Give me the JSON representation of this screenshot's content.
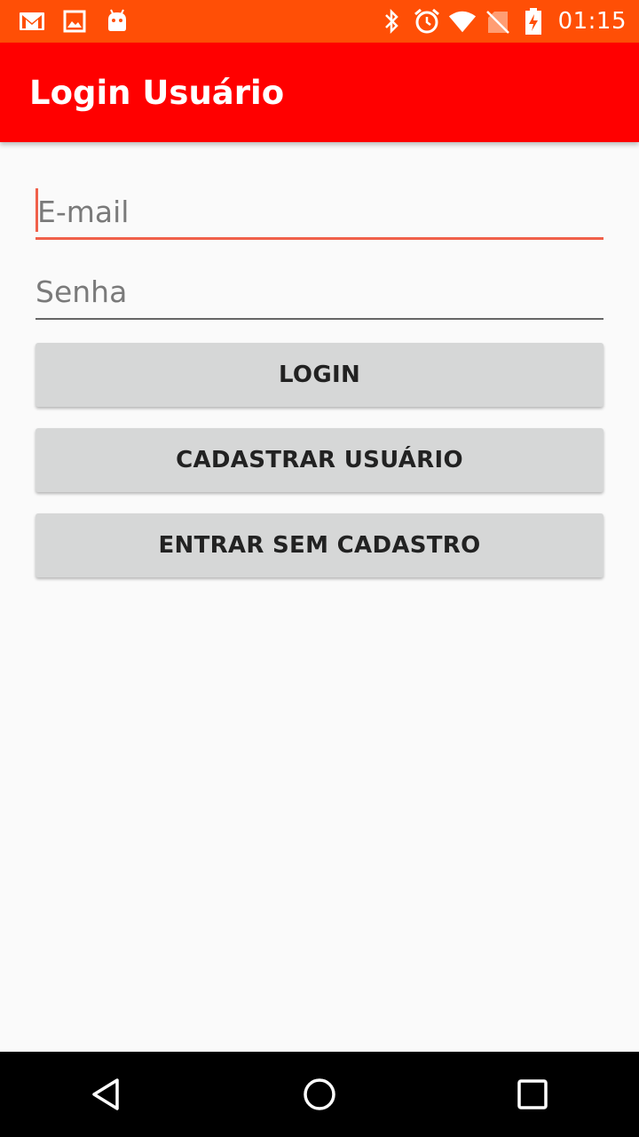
{
  "status_bar": {
    "time": "01:15",
    "left_icons": [
      "gmail-icon",
      "image-icon",
      "android-icon"
    ],
    "right_icons": [
      "bluetooth-icon",
      "alarm-icon",
      "wifi-icon",
      "no-sim-icon",
      "battery-charging-icon"
    ],
    "background": "#ff4f06"
  },
  "app_bar": {
    "title": "Login Usuário",
    "background": "#ff0000"
  },
  "form": {
    "email": {
      "placeholder": "E-mail",
      "value": ""
    },
    "senha": {
      "placeholder": "Senha",
      "value": ""
    },
    "accent": "#f0604a"
  },
  "buttons": {
    "login": "LOGIN",
    "cadastrar": "CADASTRAR USUÁRIO",
    "entrar_sem_cadastro": "ENTRAR SEM CADASTRO"
  },
  "nav_bar": {
    "icons": [
      "back-icon",
      "home-icon",
      "recents-icon"
    ]
  }
}
